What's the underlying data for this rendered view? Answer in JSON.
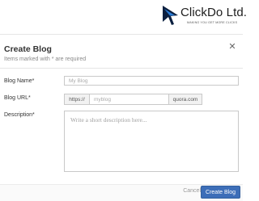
{
  "header": {
    "logo": {
      "brand": "ClickDo Ltd.",
      "tagline": "MAKING YOU GET MORE CLICKS",
      "icon": "clickdo-logo-icon",
      "colors": {
        "dark": "#0b1f3f",
        "accent": "#2a7bd6"
      }
    }
  },
  "modal": {
    "title": "Create Blog",
    "subtitle": "Items marked with * are required",
    "close_icon": "close-icon",
    "fields": {
      "blog_name": {
        "label": "Blog Name*",
        "value": "",
        "placeholder": "My Blog"
      },
      "blog_url": {
        "label": "Blog URL*",
        "prefix": "https://",
        "value": "",
        "placeholder": "myblog",
        "suffix": "quora.com"
      },
      "description": {
        "label": "Description*",
        "value": "",
        "placeholder": "Write a short description here..."
      }
    },
    "footer": {
      "cancel_label": "Cancel",
      "create_label": "Create Blog"
    }
  },
  "colors": {
    "primary_button": "#3d6eb8",
    "border": "#c9c9c9",
    "muted_text": "#8a8a8a"
  }
}
